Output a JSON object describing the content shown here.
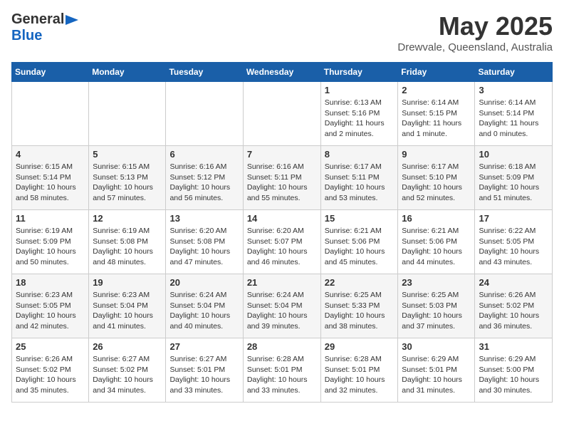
{
  "header": {
    "logo_general": "General",
    "logo_blue": "Blue",
    "month_title": "May 2025",
    "location": "Drewvale, Queensland, Australia"
  },
  "days_of_week": [
    "Sunday",
    "Monday",
    "Tuesday",
    "Wednesday",
    "Thursday",
    "Friday",
    "Saturday"
  ],
  "weeks": [
    [
      {
        "day": "",
        "info": ""
      },
      {
        "day": "",
        "info": ""
      },
      {
        "day": "",
        "info": ""
      },
      {
        "day": "",
        "info": ""
      },
      {
        "day": "1",
        "info": "Sunrise: 6:13 AM\nSunset: 5:16 PM\nDaylight: 11 hours\nand 2 minutes."
      },
      {
        "day": "2",
        "info": "Sunrise: 6:14 AM\nSunset: 5:15 PM\nDaylight: 11 hours\nand 1 minute."
      },
      {
        "day": "3",
        "info": "Sunrise: 6:14 AM\nSunset: 5:14 PM\nDaylight: 11 hours\nand 0 minutes."
      }
    ],
    [
      {
        "day": "4",
        "info": "Sunrise: 6:15 AM\nSunset: 5:14 PM\nDaylight: 10 hours\nand 58 minutes."
      },
      {
        "day": "5",
        "info": "Sunrise: 6:15 AM\nSunset: 5:13 PM\nDaylight: 10 hours\nand 57 minutes."
      },
      {
        "day": "6",
        "info": "Sunrise: 6:16 AM\nSunset: 5:12 PM\nDaylight: 10 hours\nand 56 minutes."
      },
      {
        "day": "7",
        "info": "Sunrise: 6:16 AM\nSunset: 5:11 PM\nDaylight: 10 hours\nand 55 minutes."
      },
      {
        "day": "8",
        "info": "Sunrise: 6:17 AM\nSunset: 5:11 PM\nDaylight: 10 hours\nand 53 minutes."
      },
      {
        "day": "9",
        "info": "Sunrise: 6:17 AM\nSunset: 5:10 PM\nDaylight: 10 hours\nand 52 minutes."
      },
      {
        "day": "10",
        "info": "Sunrise: 6:18 AM\nSunset: 5:09 PM\nDaylight: 10 hours\nand 51 minutes."
      }
    ],
    [
      {
        "day": "11",
        "info": "Sunrise: 6:19 AM\nSunset: 5:09 PM\nDaylight: 10 hours\nand 50 minutes."
      },
      {
        "day": "12",
        "info": "Sunrise: 6:19 AM\nSunset: 5:08 PM\nDaylight: 10 hours\nand 48 minutes."
      },
      {
        "day": "13",
        "info": "Sunrise: 6:20 AM\nSunset: 5:08 PM\nDaylight: 10 hours\nand 47 minutes."
      },
      {
        "day": "14",
        "info": "Sunrise: 6:20 AM\nSunset: 5:07 PM\nDaylight: 10 hours\nand 46 minutes."
      },
      {
        "day": "15",
        "info": "Sunrise: 6:21 AM\nSunset: 5:06 PM\nDaylight: 10 hours\nand 45 minutes."
      },
      {
        "day": "16",
        "info": "Sunrise: 6:21 AM\nSunset: 5:06 PM\nDaylight: 10 hours\nand 44 minutes."
      },
      {
        "day": "17",
        "info": "Sunrise: 6:22 AM\nSunset: 5:05 PM\nDaylight: 10 hours\nand 43 minutes."
      }
    ],
    [
      {
        "day": "18",
        "info": "Sunrise: 6:23 AM\nSunset: 5:05 PM\nDaylight: 10 hours\nand 42 minutes."
      },
      {
        "day": "19",
        "info": "Sunrise: 6:23 AM\nSunset: 5:04 PM\nDaylight: 10 hours\nand 41 minutes."
      },
      {
        "day": "20",
        "info": "Sunrise: 6:24 AM\nSunset: 5:04 PM\nDaylight: 10 hours\nand 40 minutes."
      },
      {
        "day": "21",
        "info": "Sunrise: 6:24 AM\nSunset: 5:04 PM\nDaylight: 10 hours\nand 39 minutes."
      },
      {
        "day": "22",
        "info": "Sunrise: 6:25 AM\nSunset: 5:33 PM\nDaylight: 10 hours\nand 38 minutes."
      },
      {
        "day": "23",
        "info": "Sunrise: 6:25 AM\nSunset: 5:03 PM\nDaylight: 10 hours\nand 37 minutes."
      },
      {
        "day": "24",
        "info": "Sunrise: 6:26 AM\nSunset: 5:02 PM\nDaylight: 10 hours\nand 36 minutes."
      }
    ],
    [
      {
        "day": "25",
        "info": "Sunrise: 6:26 AM\nSunset: 5:02 PM\nDaylight: 10 hours\nand 35 minutes."
      },
      {
        "day": "26",
        "info": "Sunrise: 6:27 AM\nSunset: 5:02 PM\nDaylight: 10 hours\nand 34 minutes."
      },
      {
        "day": "27",
        "info": "Sunrise: 6:27 AM\nSunset: 5:01 PM\nDaylight: 10 hours\nand 33 minutes."
      },
      {
        "day": "28",
        "info": "Sunrise: 6:28 AM\nSunset: 5:01 PM\nDaylight: 10 hours\nand 33 minutes."
      },
      {
        "day": "29",
        "info": "Sunrise: 6:28 AM\nSunset: 5:01 PM\nDaylight: 10 hours\nand 32 minutes."
      },
      {
        "day": "30",
        "info": "Sunrise: 6:29 AM\nSunset: 5:01 PM\nDaylight: 10 hours\nand 31 minutes."
      },
      {
        "day": "31",
        "info": "Sunrise: 6:29 AM\nSunset: 5:00 PM\nDaylight: 10 hours\nand 30 minutes."
      }
    ]
  ]
}
